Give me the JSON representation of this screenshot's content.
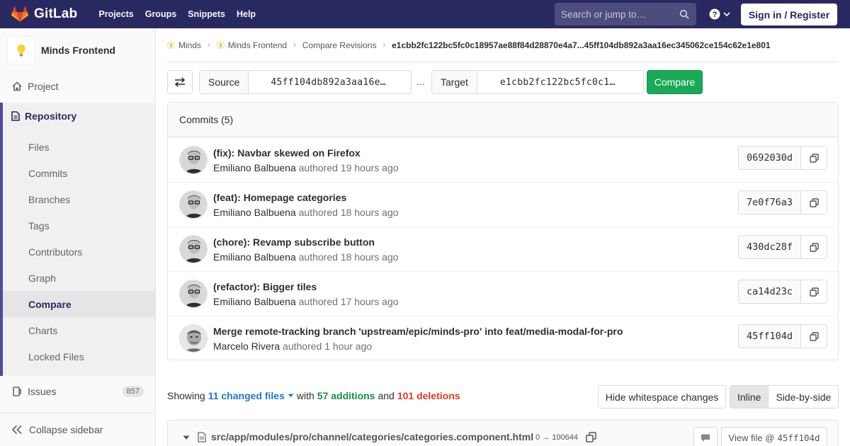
{
  "navbar": {
    "brand": "GitLab",
    "links": [
      "Projects",
      "Groups",
      "Snippets",
      "Help"
    ],
    "search_placeholder": "Search or jump to…",
    "signin_label": "Sign in / Register"
  },
  "sidebar": {
    "project_name": "Minds Frontend",
    "project_label": "Project",
    "repository_label": "Repository",
    "repo_items": [
      "Files",
      "Commits",
      "Branches",
      "Tags",
      "Contributors",
      "Graph",
      "Compare",
      "Charts",
      "Locked Files"
    ],
    "active_item": "Compare",
    "issues_label": "Issues",
    "issues_count": "857",
    "collapse_label": "Collapse sidebar"
  },
  "breadcrumb": {
    "items": [
      "Minds",
      "Minds Frontend",
      "Compare Revisions",
      "e1cbb2fc122bc5fc0c18957ae88f84d28870e4a7...45ff104db892a3aa16ec345062ce154c62e1e801"
    ]
  },
  "compare": {
    "source_label": "Source",
    "source_value": "45ff104db892a3aa16e…",
    "separator": "...",
    "target_label": "Target",
    "target_value": "e1cbb2fc122bc5fc0c1…",
    "compare_label": "Compare"
  },
  "commits": {
    "header": "Commits (5)",
    "items": [
      {
        "title": "(fix): Navbar skewed on Firefox",
        "author": "Emiliano Balbuena",
        "action": "authored",
        "time": "19 hours ago",
        "sha": "0692030d"
      },
      {
        "title": "(feat): Homepage categories",
        "author": "Emiliano Balbuena",
        "action": "authored",
        "time": "18 hours ago",
        "sha": "7e0f76a3"
      },
      {
        "title": "(chore): Revamp subscribe button",
        "author": "Emiliano Balbuena",
        "action": "authored",
        "time": "18 hours ago",
        "sha": "430dc28f"
      },
      {
        "title": "(refactor): Bigger tiles",
        "author": "Emiliano Balbuena",
        "action": "authored",
        "time": "17 hours ago",
        "sha": "ca14d23c"
      },
      {
        "title": "Merge remote-tracking branch 'upstream/epic/minds-pro' into feat/media-modal-for-pro",
        "author": "Marcelo Rivera",
        "action": "authored",
        "time": "1 hour ago",
        "sha": "45ff104d"
      }
    ]
  },
  "diff_summary": {
    "showing": "Showing",
    "changed_files": "11 changed files",
    "with": "with",
    "additions": "57 additions",
    "and": "and",
    "deletions": "101 deletions",
    "hide_whitespace_label": "Hide whitespace changes",
    "inline_label": "Inline",
    "side_by_side_label": "Side-by-side"
  },
  "file": {
    "path": "src/app/modules/pro/channel/categories/categories.component.html",
    "mode": "0 → 100644",
    "view_label": "View file @",
    "view_sha": "45ff104d"
  },
  "colors": {
    "navbar": "#292961",
    "accent": "#4b4ba3",
    "compare_button": "#1aaa55",
    "additions": "#168f48",
    "deletions": "#db3b21",
    "link": "#1f78d1"
  }
}
